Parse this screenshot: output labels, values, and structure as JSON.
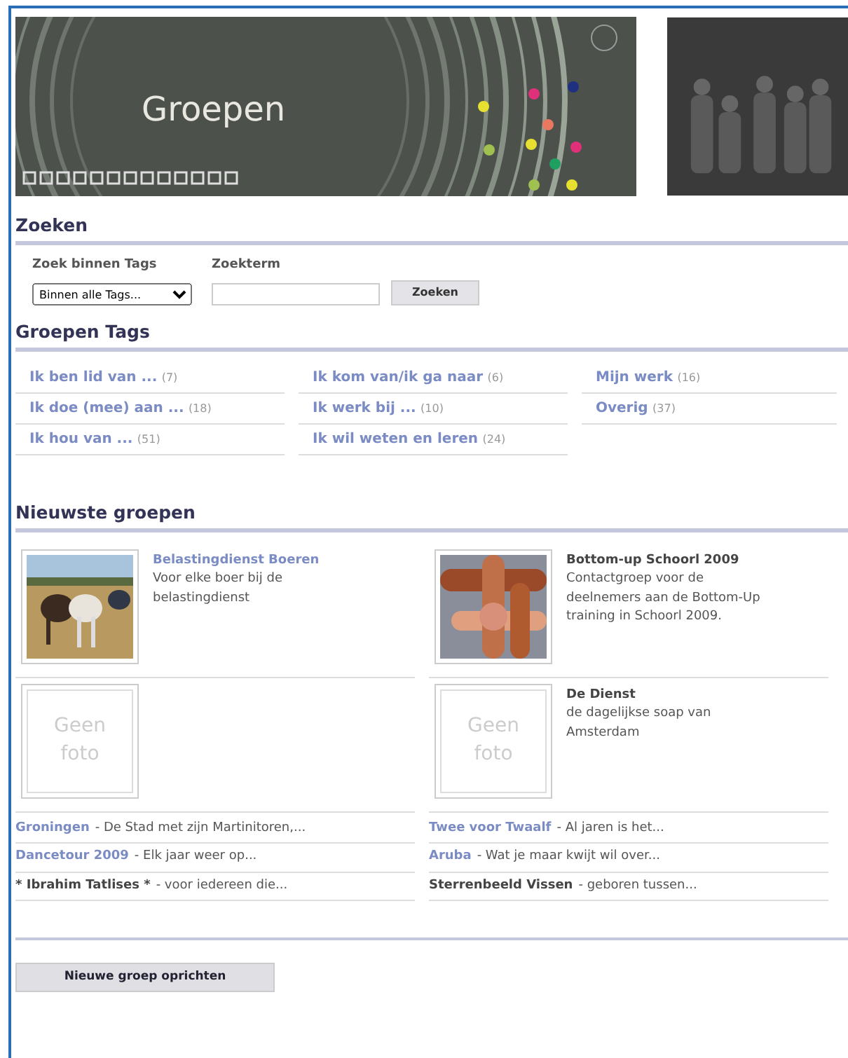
{
  "banner": {
    "title": "Groepen"
  },
  "search": {
    "heading": "Zoeken",
    "tag_label": "Zoek binnen Tags",
    "tag_value": "Binnen alle Tags...",
    "term_label": "Zoekterm",
    "button": "Zoeken"
  },
  "tags": {
    "heading": "Groepen Tags",
    "items": [
      {
        "label": "Ik ben lid van ...",
        "count": "(7)"
      },
      {
        "label": "Ik kom van/ik ga naar",
        "count": "(6)"
      },
      {
        "label": "Mijn werk",
        "count": "(16)"
      },
      {
        "label": "Ik doe (mee) aan ...",
        "count": "(18)"
      },
      {
        "label": "Ik werk bij ...",
        "count": "(10)"
      },
      {
        "label": "Overig",
        "count": "(37)"
      },
      {
        "label": "Ik hou van ...",
        "count": "(51)"
      },
      {
        "label": "Ik wil weten en leren",
        "count": "(24)"
      }
    ]
  },
  "newest": {
    "heading": "Nieuwste groepen",
    "featured": [
      {
        "name": "Belastingdienst Boeren",
        "visited": false,
        "description": "Voor elke boer bij de belastingdienst",
        "kind": "picture"
      },
      {
        "name": "Bottom-up Schoorl 2009",
        "visited": true,
        "description": "Contactgroep voor de deelnemers aan de Bottom-Up training in Schoorl 2009.",
        "kind": "picture"
      },
      {
        "kind": "placeholder",
        "photo_placeholder": "Geen foto"
      },
      {
        "name": "De Dienst",
        "visited": true,
        "description": "de dagelijkse soap van Amsterdam",
        "kind": "placeholder",
        "photo_placeholder": "Geen foto"
      }
    ],
    "list": [
      {
        "name": "Groningen",
        "visited": false,
        "teaser": "- De Stad met zijn Martinitoren,..."
      },
      {
        "name": "Twee voor Twaalf",
        "visited": false,
        "teaser": "- Al jaren is het..."
      },
      {
        "name": "Dancetour 2009",
        "visited": false,
        "teaser": "- Elk jaar weer op..."
      },
      {
        "name": "Aruba",
        "visited": false,
        "teaser": "- Wat je maar kwijt wil over..."
      },
      {
        "name": "* Ibrahim Tatlises *",
        "visited": true,
        "teaser": "- voor iedereen die..."
      },
      {
        "name": "Sterrenbeeld Vissen",
        "visited": true,
        "teaser": "- geboren tussen..."
      }
    ]
  },
  "create_button": "Nieuwe groep oprichten"
}
